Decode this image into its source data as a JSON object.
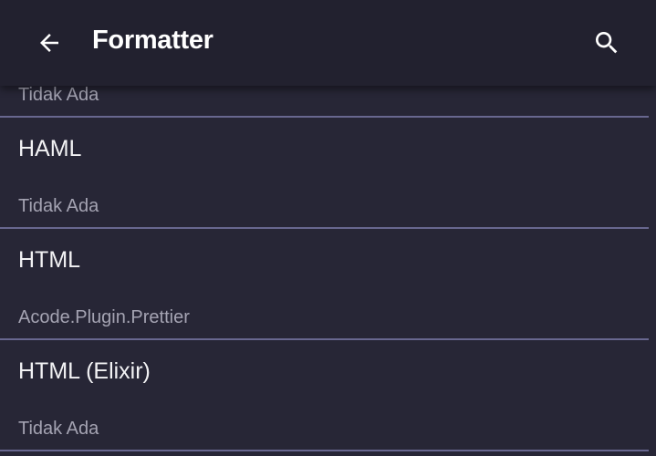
{
  "header": {
    "title": "Formatter",
    "back_icon": "arrow-left-icon",
    "search_icon": "search-icon"
  },
  "colors": {
    "background": "#272636",
    "header_background": "#22212f",
    "divider": "#68678f",
    "title_text": "#f2f2f4",
    "subtitle_text": "#a4a3b2"
  },
  "list": {
    "items": [
      {
        "title": "",
        "subtitle": "Tidak Ada"
      },
      {
        "title": "HAML",
        "subtitle": "Tidak Ada"
      },
      {
        "title": "HTML",
        "subtitle": "Acode.Plugin.Prettier"
      },
      {
        "title": "HTML (Elixir)",
        "subtitle": "Tidak Ada"
      }
    ]
  }
}
